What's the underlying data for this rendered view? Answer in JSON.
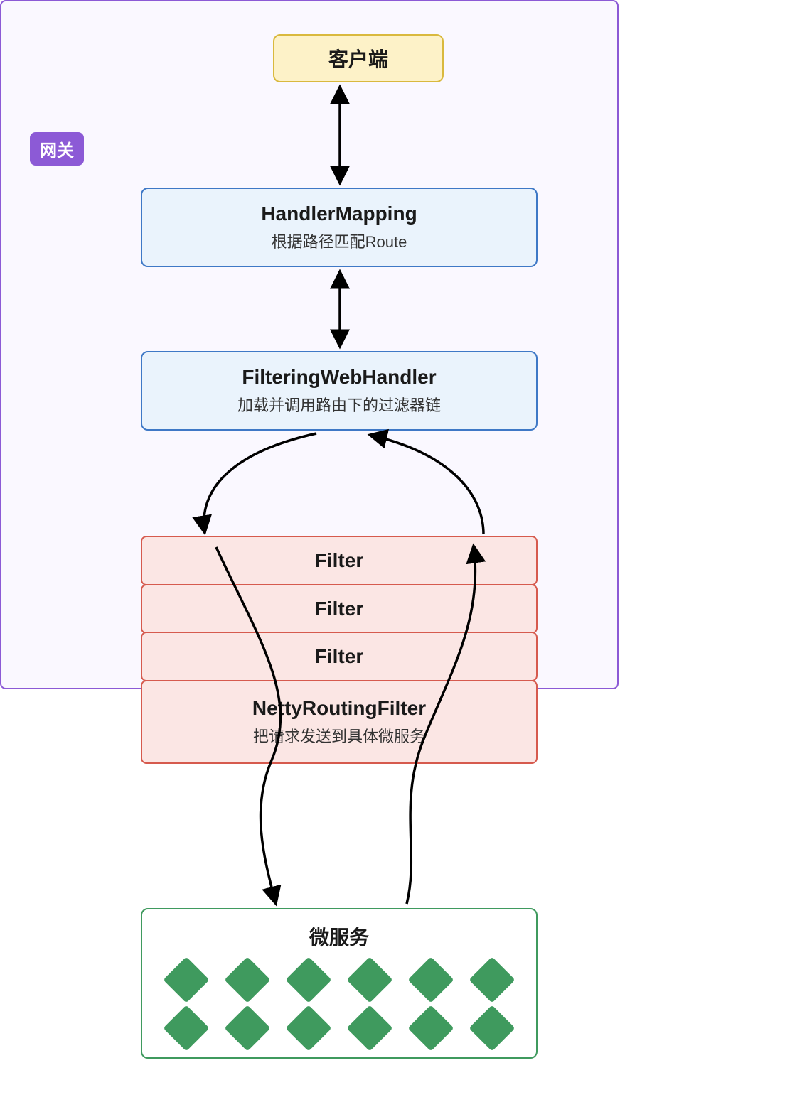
{
  "client": {
    "label": "客户端"
  },
  "gateway": {
    "tag": "网关"
  },
  "handlerMapping": {
    "title": "HandlerMapping",
    "sub": "根据路径匹配Route"
  },
  "filteringWebHandler": {
    "title": "FilteringWebHandler",
    "sub": "加载并调用路由下的过滤器链"
  },
  "filters": {
    "row1": "Filter",
    "row2": "Filter",
    "row3": "Filter",
    "routing_title": "NettyRoutingFilter",
    "routing_sub": "把请求发送到具体微服务"
  },
  "microservice": {
    "title": "微服务",
    "instance_count": 12
  },
  "colors": {
    "client_bg": "#fdf2c8",
    "client_border": "#d9b93e",
    "gateway_bg": "#faf8ff",
    "gateway_border": "#8c5ad6",
    "blue_bg": "#eaf3fc",
    "blue_border": "#3e78c6",
    "red_bg": "#fbe6e4",
    "red_border": "#d65a4e",
    "green": "#3f9a5e"
  }
}
